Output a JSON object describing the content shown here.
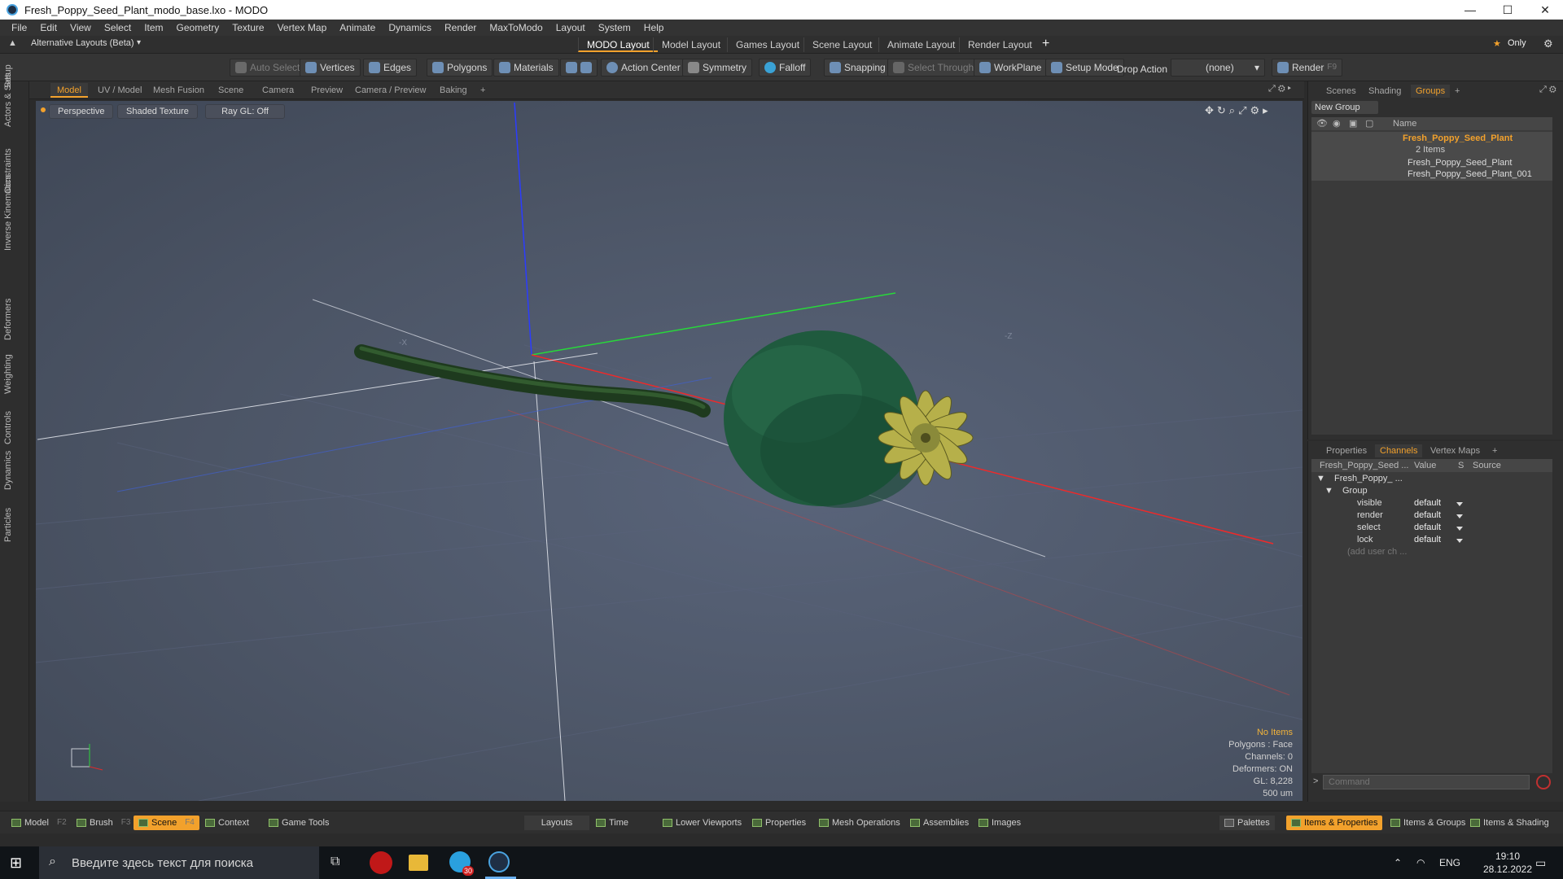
{
  "window": {
    "title": "Fresh_Poppy_Seed_Plant_modo_base.lxo - MODO"
  },
  "menu": [
    "File",
    "Edit",
    "View",
    "Select",
    "Item",
    "Geometry",
    "Texture",
    "Vertex Map",
    "Animate",
    "Dynamics",
    "Render",
    "MaxToModo",
    "Layout",
    "System",
    "Help"
  ],
  "layoutbar": {
    "alt_layout": "Alternative Layouts (Beta)",
    "tabs": [
      "MODO Layout",
      "Model Layout",
      "Games Layout",
      "Scene Layout",
      "Animate Layout",
      "Render Layout"
    ],
    "add": "+",
    "only": "Only"
  },
  "toolbar": {
    "auto_select": "Auto Select",
    "vertices": "Vertices",
    "edges": "Edges",
    "polygons": "Polygons",
    "materials": "Materials",
    "action_center": "Action Center",
    "symmetry": "Symmetry",
    "falloff": "Falloff",
    "snapping": "Snapping",
    "select_through": "Select Through",
    "workplane": "WorkPlane",
    "setup_mode": "Setup Mode",
    "drop_action": "Drop Action",
    "drop_value": "(none)",
    "render": "Render",
    "render_key": "F9"
  },
  "left_tabs": [
    "Setup",
    "Actors & Sets",
    "Constraints",
    "Inverse Kinematics",
    "Deformers",
    "Weighting",
    "Controls",
    "Dynamics",
    "Particles"
  ],
  "viewport_tabs": [
    "Model",
    "UV / Model",
    "Mesh Fusion",
    "Scene",
    "Camera",
    "Preview",
    "Camera / Preview",
    "Baking",
    "+"
  ],
  "viewport": {
    "view": "Perspective",
    "shading": "Shaded Texture",
    "raygl": "Ray GL: Off",
    "stats": {
      "items": "No Items",
      "polygons": "Polygons : Face",
      "channels": "Channels: 0",
      "deformers": "Deformers: ON",
      "gl": "GL: 8,228",
      "scale": "500 um"
    }
  },
  "groups_panel": {
    "tabs": [
      "Scenes",
      "Shading",
      "Groups",
      "+"
    ],
    "new_group": "New Group",
    "col_name": "Name",
    "group_name": "Fresh_Poppy_Seed_Plant",
    "group_count": "2 Items",
    "children": [
      "Fresh_Poppy_Seed_Plant",
      "Fresh_Poppy_Seed_Plant_001"
    ]
  },
  "channels_panel": {
    "tabs": [
      "Properties",
      "Channels",
      "Vertex Maps",
      "+"
    ],
    "col_item": "Fresh_Poppy_Seed ...",
    "col_value": "Value",
    "col_s": "S",
    "col_source": "Source",
    "root": "Fresh_Poppy_ ...",
    "group": "Group",
    "rows": [
      {
        "name": "visible",
        "value": "default"
      },
      {
        "name": "render",
        "value": "default"
      },
      {
        "name": "select",
        "value": "default"
      },
      {
        "name": "lock",
        "value": "default"
      }
    ],
    "add_user": "(add user ch ...",
    "command_placeholder": "Command"
  },
  "bottombar": {
    "left": [
      {
        "label": "Model",
        "key": "F2"
      },
      {
        "label": "Brush",
        "key": "F3"
      },
      {
        "label": "Scene",
        "key": "F4"
      },
      {
        "label": "Context",
        "key": ""
      },
      {
        "label": "Game Tools",
        "key": ""
      }
    ],
    "middle": [
      "Layouts",
      "Time",
      "Lower Viewports",
      "Properties",
      "Mesh Operations",
      "Assemblies",
      "Images"
    ],
    "right": [
      "Palettes",
      "Items & Properties",
      "Items & Groups",
      "Items & Shading"
    ]
  },
  "taskbar": {
    "search_placeholder": "Введите здесь текст для поиска",
    "telegram_badge": "30",
    "lang": "ENG",
    "time": "19:10",
    "date": "28.12.2022"
  },
  "colors": {
    "accent": "#f2a12c",
    "viewport": "#4c5566"
  }
}
